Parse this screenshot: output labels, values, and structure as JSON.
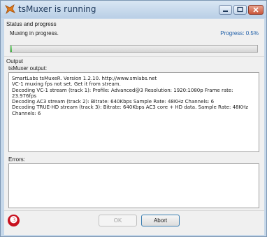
{
  "window": {
    "title": "tsMuxer is running"
  },
  "status": {
    "group_label": "Status and progress",
    "message": "Muxing in progress.",
    "progress_text": "Progress: 0.5%",
    "progress_fraction": 0.005
  },
  "output": {
    "group_label": "Output",
    "field_label": "tsMuxer output:",
    "lines": [
      "SmartLabs tsMuxeR.  Version 1.2.10.  http://www.smlabs.net",
      "VC-1 muxing fps not set. Get it from stream.",
      "Decoding VC-1 stream (track 1): Profile: Advanced@3 Resolution: 1920:1080p  Frame rate:",
      "23.976fps",
      "Decoding AC3 stream (track 2): Bitrate: 640Kbps Sample Rate: 48KHz Channels: 6",
      "Decoding TRUE-HD stream (track 3): Bitrate: 640Kbps AC3 core + HD data. Sample Rate: 48KHz",
      "Channels: 6"
    ]
  },
  "errors": {
    "label": "Errors:",
    "value": ""
  },
  "buttons": {
    "ok_label": "OK",
    "abort_label": "Abort"
  },
  "annotation": {
    "badge_text": "❸"
  },
  "colors": {
    "title_text": "#1e395b",
    "frame": "#c6d8ea",
    "progress_fill": "#3fb33f",
    "badge": "#c8101e"
  }
}
